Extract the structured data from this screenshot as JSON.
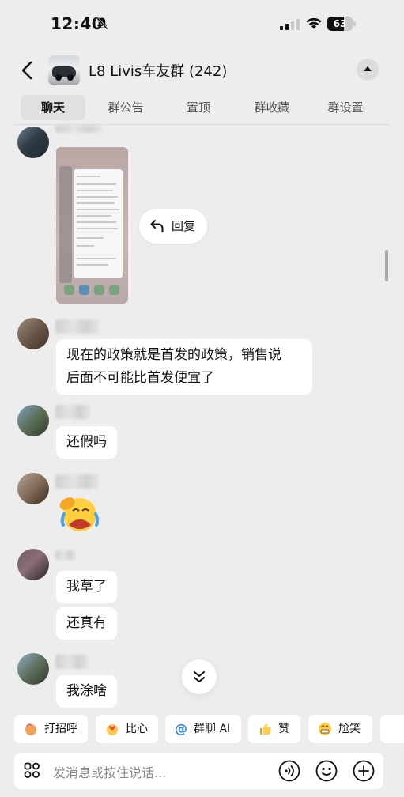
{
  "status_bar": {
    "time": "12:40",
    "battery": "63"
  },
  "header": {
    "title": "L8 Livis车友群 (242)"
  },
  "tabs": [
    {
      "label": "聊天",
      "active": true
    },
    {
      "label": "群公告",
      "active": false
    },
    {
      "label": "置顶",
      "active": false
    },
    {
      "label": "群收藏",
      "active": false
    },
    {
      "label": "群设置",
      "active": false
    }
  ],
  "messages": {
    "reply_action": "回复",
    "m2": "现在的政策就是首发的政策，销售说\n后面不可能比首发便宜了",
    "m3": "还假吗",
    "m5a": "我草了",
    "m5b": "还真有",
    "m6": "我涂啥"
  },
  "quick_replies": [
    "打招呼",
    "比心",
    "群聊 AI",
    "赞",
    "尬笑"
  ],
  "input": {
    "placeholder": "发消息或按住说话..."
  },
  "icons": [
    "back-arrow-icon",
    "mute-bell-icon",
    "signal-icon",
    "wifi-icon",
    "battery-icon",
    "reply-arrow-icon",
    "scroll-down-icon",
    "apps-grid-icon",
    "voice-icon",
    "emoji-icon",
    "plus-icon"
  ]
}
